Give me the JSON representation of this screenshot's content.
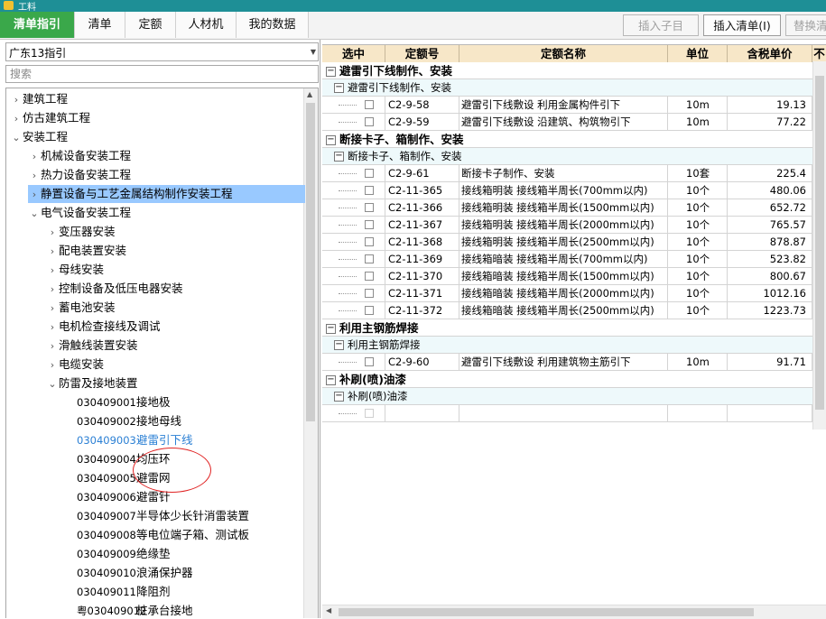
{
  "window": {
    "title": "工料"
  },
  "tabs": [
    "清单指引",
    "清单",
    "定额",
    "人材机",
    "我的数据"
  ],
  "toolbar": {
    "insert_child": "插入子目",
    "insert_list": "插入清单(I)",
    "replace": "替换清"
  },
  "left": {
    "province_select": "广东13指引",
    "search_placeholder": "搜索",
    "tree": [
      {
        "text": "建筑工程",
        "level": 0,
        "state": "collapsed"
      },
      {
        "text": "仿古建筑工程",
        "level": 0,
        "state": "collapsed"
      },
      {
        "text": "安装工程",
        "level": 0,
        "state": "expanded"
      },
      {
        "text": "机械设备安装工程",
        "level": 1,
        "state": "collapsed"
      },
      {
        "text": "热力设备安装工程",
        "level": 1,
        "state": "collapsed"
      },
      {
        "text": "静置设备与工艺金属结构制作安装工程",
        "level": 1,
        "state": "collapsed",
        "selected": true
      },
      {
        "text": "电气设备安装工程",
        "level": 1,
        "state": "expanded"
      },
      {
        "text": "变压器安装",
        "level": 2,
        "state": "collapsed"
      },
      {
        "text": "配电装置安装",
        "level": 2,
        "state": "collapsed"
      },
      {
        "text": "母线安装",
        "level": 2,
        "state": "collapsed"
      },
      {
        "text": "控制设备及低压电器安装",
        "level": 2,
        "state": "collapsed"
      },
      {
        "text": "蓄电池安装",
        "level": 2,
        "state": "collapsed"
      },
      {
        "text": "电机检查接线及调试",
        "level": 2,
        "state": "collapsed"
      },
      {
        "text": "滑触线装置安装",
        "level": 2,
        "state": "collapsed"
      },
      {
        "text": "电缆安装",
        "level": 2,
        "state": "collapsed"
      },
      {
        "text": "防雷及接地装置",
        "level": 2,
        "state": "expanded"
      },
      {
        "code": "030409001",
        "text": "接地极",
        "level": 3,
        "state": "leaf"
      },
      {
        "code": "030409002",
        "text": "接地母线",
        "level": 3,
        "state": "leaf"
      },
      {
        "code": "030409003",
        "text": "避雷引下线",
        "level": 3,
        "state": "leaf",
        "active": true
      },
      {
        "code": "030409004",
        "text": "均压环",
        "level": 3,
        "state": "leaf"
      },
      {
        "code": "030409005",
        "text": "避雷网",
        "level": 3,
        "state": "leaf"
      },
      {
        "code": "030409006",
        "text": "避雷针",
        "level": 3,
        "state": "leaf"
      },
      {
        "code": "030409007",
        "text": "半导体少长针消雷装置",
        "level": 3,
        "state": "leaf"
      },
      {
        "code": "030409008",
        "text": "等电位端子箱、测试板",
        "level": 3,
        "state": "leaf"
      },
      {
        "code": "030409009",
        "text": "绝缘垫",
        "level": 3,
        "state": "leaf"
      },
      {
        "code": "030409010",
        "text": "浪涌保护器",
        "level": 3,
        "state": "leaf"
      },
      {
        "code": "030409011",
        "text": "降阻剂",
        "level": 3,
        "state": "leaf"
      },
      {
        "code": "粤030409012",
        "text": "桩承台接地",
        "level": 3,
        "state": "leaf"
      }
    ]
  },
  "grid": {
    "headers": [
      "选中",
      "定额号",
      "定额名称",
      "单位",
      "含税单价",
      "不"
    ],
    "rows": [
      {
        "type": "g1",
        "label": "避雷引下线制作、安装"
      },
      {
        "type": "g2",
        "label": "避雷引下线制作、安装"
      },
      {
        "type": "item",
        "code": "C2-9-58",
        "name": "避雷引下线敷设 利用金属构件引下",
        "unit": "10m",
        "price": "19.13"
      },
      {
        "type": "item",
        "code": "C2-9-59",
        "name": "避雷引下线敷设 沿建筑、构筑物引下",
        "unit": "10m",
        "price": "77.22"
      },
      {
        "type": "g1",
        "label": "断接卡子、箱制作、安装"
      },
      {
        "type": "g2",
        "label": "断接卡子、箱制作、安装"
      },
      {
        "type": "item",
        "code": "C2-9-61",
        "name": "断接卡子制作、安装",
        "unit": "10套",
        "price": "225.4"
      },
      {
        "type": "item",
        "code": "C2-11-365",
        "name": "接线箱明装 接线箱半周长(700mm以内)",
        "unit": "10个",
        "price": "480.06"
      },
      {
        "type": "item",
        "code": "C2-11-366",
        "name": "接线箱明装 接线箱半周长(1500mm以内)",
        "unit": "10个",
        "price": "652.72"
      },
      {
        "type": "item",
        "code": "C2-11-367",
        "name": "接线箱明装 接线箱半周长(2000mm以内)",
        "unit": "10个",
        "price": "765.57"
      },
      {
        "type": "item",
        "code": "C2-11-368",
        "name": "接线箱明装 接线箱半周长(2500mm以内)",
        "unit": "10个",
        "price": "878.87"
      },
      {
        "type": "item",
        "code": "C2-11-369",
        "name": "接线箱暗装 接线箱半周长(700mm以内)",
        "unit": "10个",
        "price": "523.82"
      },
      {
        "type": "item",
        "code": "C2-11-370",
        "name": "接线箱暗装 接线箱半周长(1500mm以内)",
        "unit": "10个",
        "price": "800.67"
      },
      {
        "type": "item",
        "code": "C2-11-371",
        "name": "接线箱暗装 接线箱半周长(2000mm以内)",
        "unit": "10个",
        "price": "1012.16"
      },
      {
        "type": "item",
        "code": "C2-11-372",
        "name": "接线箱暗装 接线箱半周长(2500mm以内)",
        "unit": "10个",
        "price": "1223.73"
      },
      {
        "type": "g1",
        "label": "利用主钢筋焊接"
      },
      {
        "type": "g2",
        "label": "利用主钢筋焊接"
      },
      {
        "type": "item",
        "code": "C2-9-60",
        "name": "避雷引下线敷设 利用建筑物主筋引下",
        "unit": "10m",
        "price": "91.71"
      },
      {
        "type": "g1",
        "label": "补刷(喷)油漆"
      },
      {
        "type": "g2",
        "label": "补刷(喷)油漆"
      },
      {
        "type": "item",
        "code": "",
        "name": "",
        "unit": "",
        "price": "",
        "dim": true
      }
    ]
  }
}
